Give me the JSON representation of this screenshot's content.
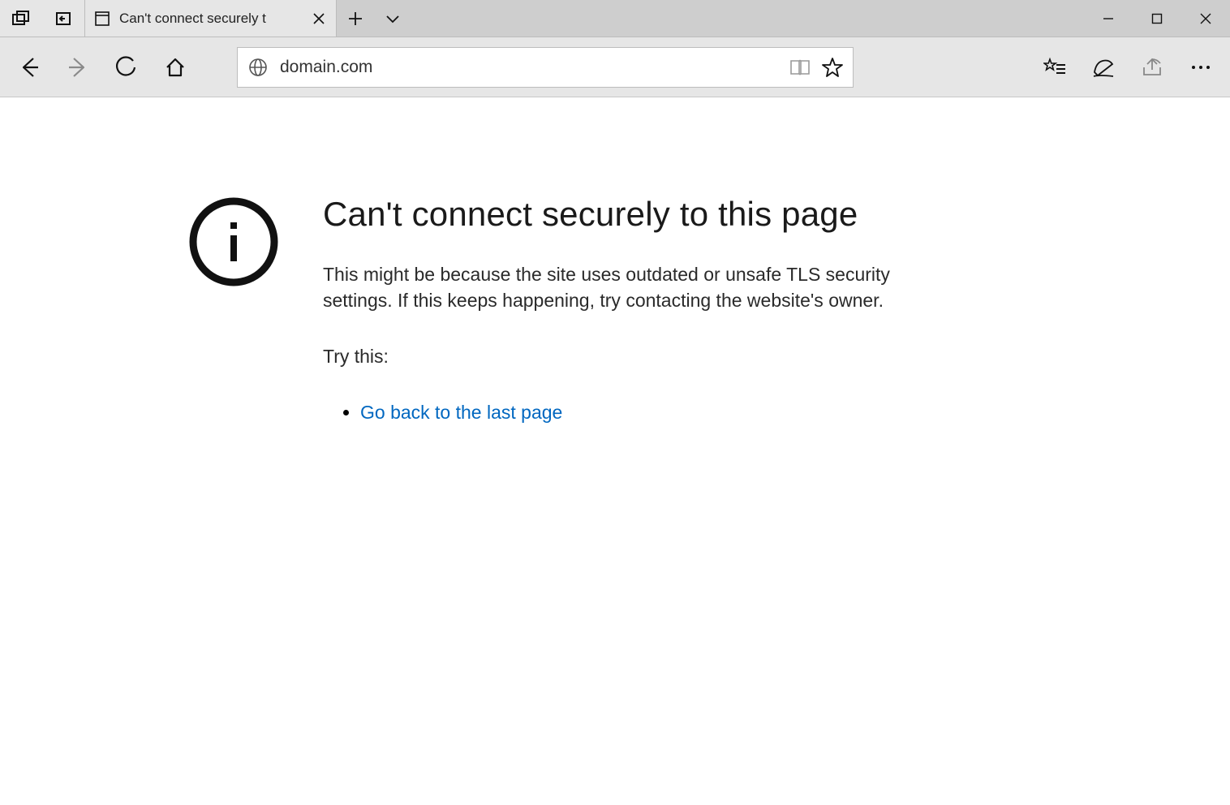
{
  "tab": {
    "title": "Can't connect securely t"
  },
  "address": {
    "url": "domain.com"
  },
  "error": {
    "heading": "Can't connect securely to this page",
    "description": "This might be because the site uses outdated or unsafe TLS security settings. If this keeps happening, try contacting the website's owner.",
    "try_label": "Try this:",
    "actions": [
      {
        "label": "Go back to the last page"
      }
    ]
  }
}
